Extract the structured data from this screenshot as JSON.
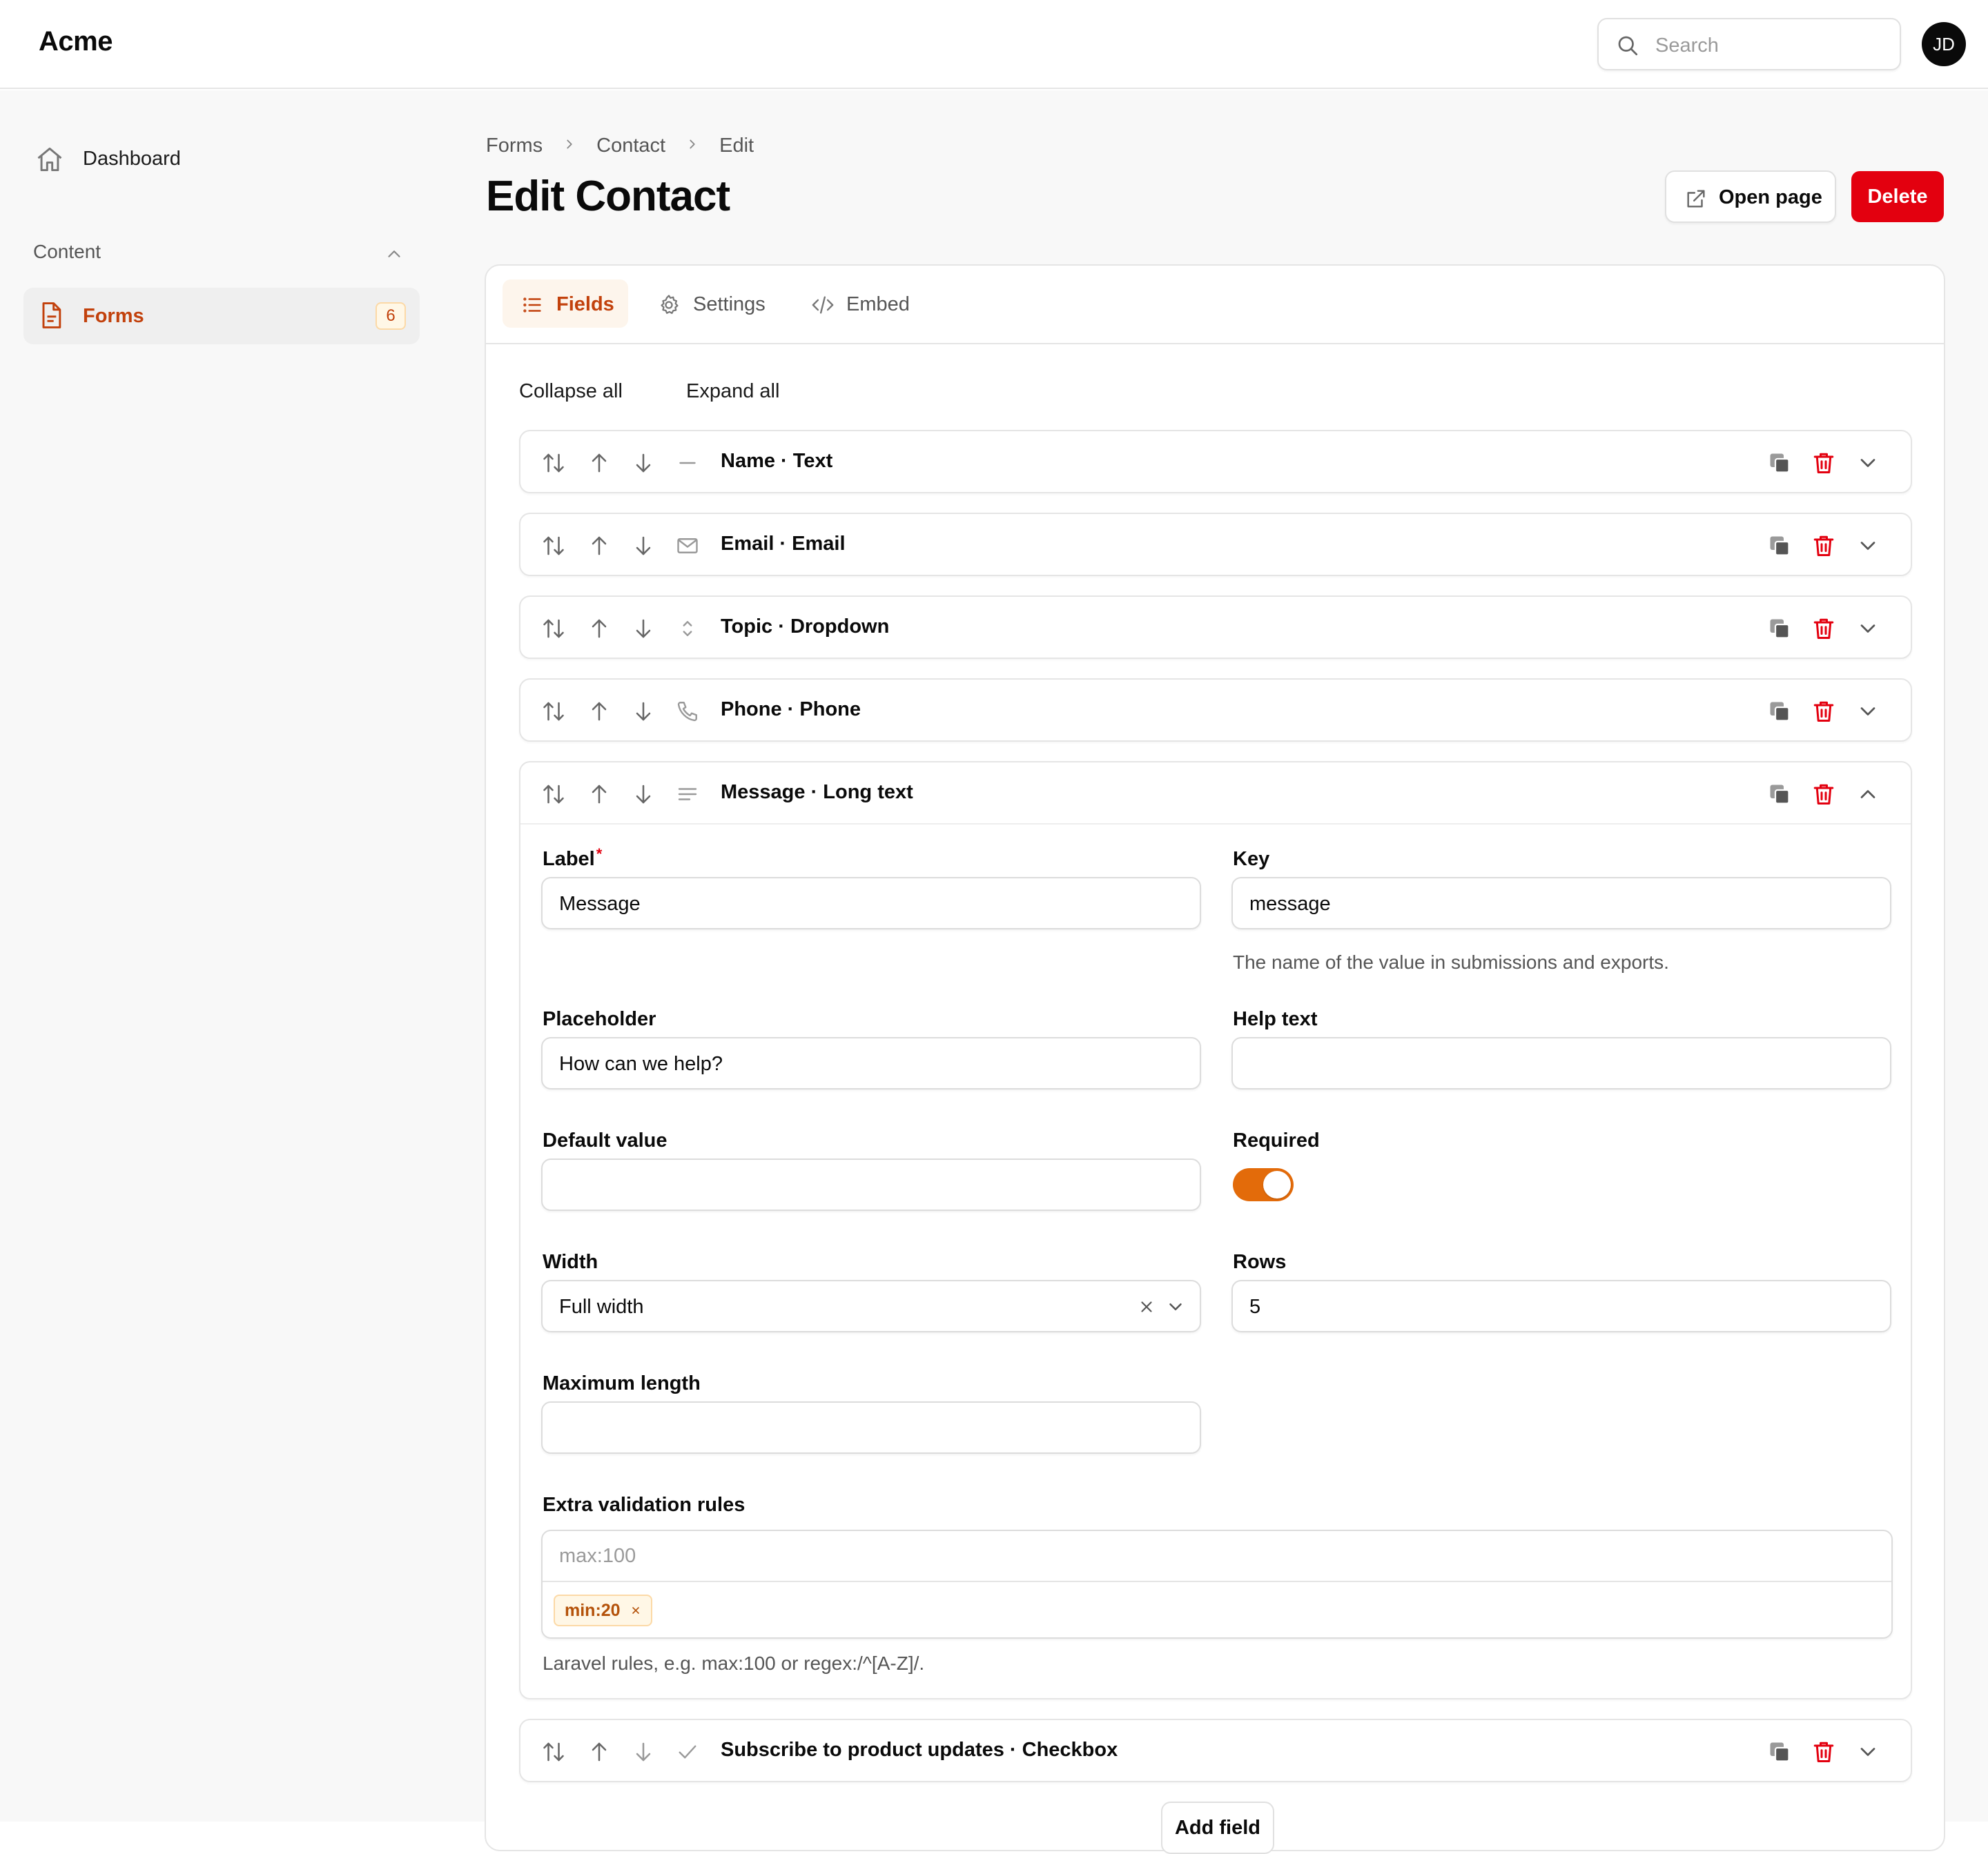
{
  "app": {
    "brand": "Acme"
  },
  "header": {
    "search_placeholder": "Search",
    "avatar_initials": "JD"
  },
  "sidebar": {
    "dashboard_label": "Dashboard",
    "group_label": "Content",
    "forms_label": "Forms",
    "forms_count": "6"
  },
  "breadcrumb": [
    "Forms",
    "Contact",
    "Edit"
  ],
  "page": {
    "title": "Edit Contact",
    "open_page_label": "Open page",
    "delete_label": "Delete"
  },
  "tabs": [
    "Fields",
    "Settings",
    "Embed"
  ],
  "bulk": {
    "collapse": "Collapse all",
    "expand": "Expand all"
  },
  "fields": [
    {
      "title": "Name · Text",
      "icon": "minus-icon"
    },
    {
      "title": "Email · Email",
      "icon": "envelope-icon"
    },
    {
      "title": "Topic · Dropdown",
      "icon": "chevron-up-down-icon"
    },
    {
      "title": "Phone · Phone",
      "icon": "phone-icon"
    },
    {
      "title": "Message · Long text",
      "icon": "text-lines-icon"
    },
    {
      "title": "Subscribe to product updates · Checkbox",
      "icon": "check-icon"
    }
  ],
  "editor": {
    "label_label": "Label",
    "label_value": "Message",
    "key_label": "Key",
    "key_value": "message",
    "key_help": "The name of the value in submissions and exports.",
    "placeholder_label": "Placeholder",
    "placeholder_value": "How can we help?",
    "help_text_label": "Help text",
    "help_text_value": "",
    "default_label": "Default value",
    "default_value": "",
    "required_label": "Required",
    "required_on": true,
    "width_label": "Width",
    "width_value": "Full width",
    "rows_label": "Rows",
    "rows_value": "5",
    "max_length_label": "Maximum length",
    "max_length_value": "",
    "rules_label": "Extra validation rules",
    "rules_placeholder": "max:100",
    "rules_tags": [
      "min:20"
    ],
    "rules_help": "Laravel rules, e.g. max:100 or regex:/^[A-Z]/."
  },
  "add_field_label": "Add field",
  "colors": {
    "accent": "#e36b0a",
    "accent_text": "#c2410c",
    "danger": "#e3000f"
  }
}
